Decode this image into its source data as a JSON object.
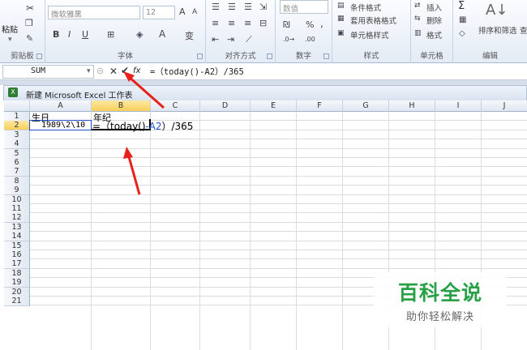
{
  "ribbon": {
    "clipboard": {
      "paste": "粘贴",
      "label": "剪贴板"
    },
    "font": {
      "name": "微软雅黑",
      "size": "12",
      "label": "字体",
      "bold": "B",
      "italic": "I",
      "underline": "U",
      "grow": "A",
      "shrink": "A",
      "pinyin": "变"
    },
    "alignment": {
      "label": "对齐方式"
    },
    "number": {
      "format": "数值",
      "label": "数字",
      "percent": "%",
      "comma": ","
    },
    "styles": {
      "conditional": "条件格式",
      "table": "套用表格格式",
      "cell": "单元格样式",
      "label": "样式"
    },
    "cells": {
      "insert": "插入",
      "delete": "删除",
      "format": "格式",
      "label": "单元格"
    },
    "editing": {
      "sum": "Σ",
      "sort": "排序和筛选",
      "find": "查",
      "label": "编辑"
    }
  },
  "formula_bar": {
    "name_box": "SUM",
    "formula": "=（today()-A2）/365",
    "fx": "fx"
  },
  "workbook": {
    "title": "新建 Microsoft Excel 工作表",
    "icon": "excel-icon"
  },
  "sheet": {
    "columns": [
      "A",
      "B",
      "C",
      "D",
      "E",
      "F",
      "G",
      "H",
      "I",
      "J"
    ],
    "selected_column": "B",
    "selected_row": "2",
    "rows": [
      "1",
      "2",
      "3",
      "4",
      "5",
      "6",
      "7",
      "8",
      "9",
      "10",
      "11",
      "12",
      "13",
      "14",
      "15",
      "16",
      "17",
      "18",
      "19",
      "20",
      "21"
    ],
    "cells": {
      "A1": "生日",
      "B1": "年纪",
      "A2": "1989\\2\\10",
      "B2_part1": "=（today()",
      "B2_ref": "-A2",
      "B2_part2": "）/365"
    }
  },
  "watermark": {
    "title": "百科全说",
    "subtitle": "助你轻松解决"
  },
  "colors": {
    "accent_green": "#27a046",
    "ref_blue": "#1f4ec8",
    "arrow_red": "#e8211a",
    "header_selected": "#f8cf58"
  }
}
